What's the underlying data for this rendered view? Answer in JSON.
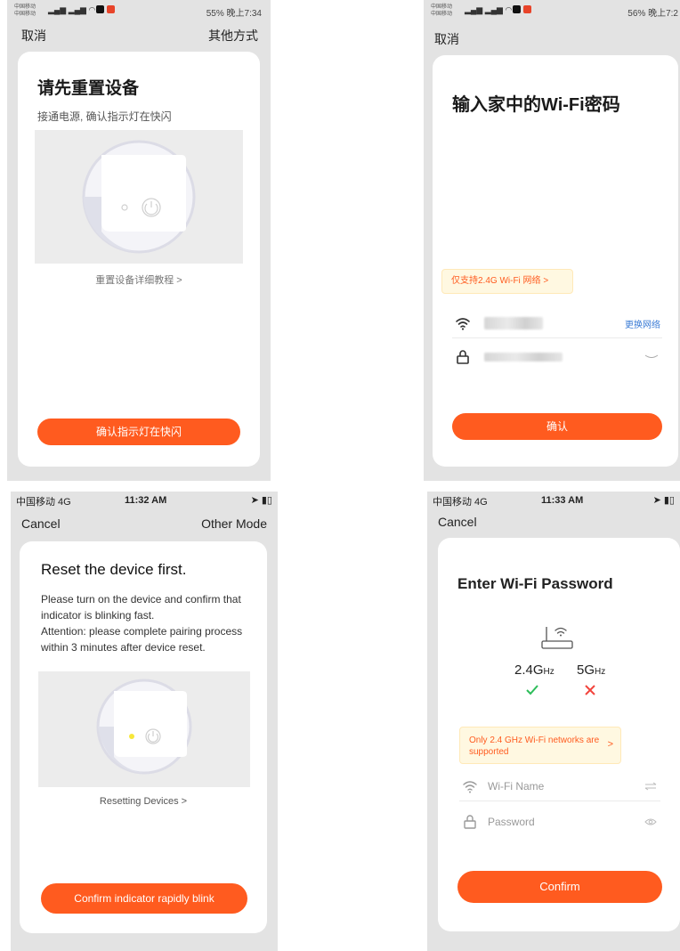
{
  "screen1": {
    "status": {
      "carrier1": "中国移动",
      "carrier2": "中国移动",
      "right": "55% 晚上7:34"
    },
    "nav": {
      "cancel": "取消",
      "other": "其他方式"
    },
    "title": "请先重置设备",
    "subtitle": "接通电源, 确认指示灯在快闪",
    "link": "重置设备详细教程 >",
    "button": "确认指示灯在快闪"
  },
  "screen2": {
    "status": {
      "carrier1": "中国移动",
      "carrier2": "中国移动",
      "right": "56% 晚上7:2"
    },
    "nav": {
      "cancel": "取消"
    },
    "title": "输入家中的Wi-Fi密码",
    "tip": "仅支持2.4G Wi-Fi 网络 >",
    "change_network": "更换网络",
    "button": "确认"
  },
  "screen3": {
    "status": {
      "carrier": "中国移动 4G",
      "time": "11:32 AM"
    },
    "nav": {
      "cancel": "Cancel",
      "other": "Other Mode"
    },
    "title": "Reset the device first.",
    "desc": "Please turn on the device and confirm that indicator is blinking fast.",
    "attention": "Attention: please complete pairing process within 3 minutes after device reset.",
    "link": "Resetting Devices >",
    "button": "Confirm indicator rapidly blink"
  },
  "screen4": {
    "status": {
      "carrier": "中国移动 4G",
      "time": "11:33 AM"
    },
    "nav": {
      "cancel": "Cancel"
    },
    "title": "Enter Wi-Fi Password",
    "band_24_main": "2.4G",
    "band_24_unit": "Hz",
    "band_5_main": "5G",
    "band_5_unit": "Hz",
    "tip": "Only 2.4 GHz Wi-Fi networks are supported",
    "tip_arrow": ">",
    "wifi_placeholder": "Wi-Fi Name",
    "password_placeholder": "Password",
    "button": "Confirm"
  },
  "colors": {
    "accent": "#ff5b1f",
    "check": "#2dbd5a",
    "cross": "#f2453d",
    "tip_bg": "#fff8e1",
    "link_blue": "#3a7bd5"
  }
}
